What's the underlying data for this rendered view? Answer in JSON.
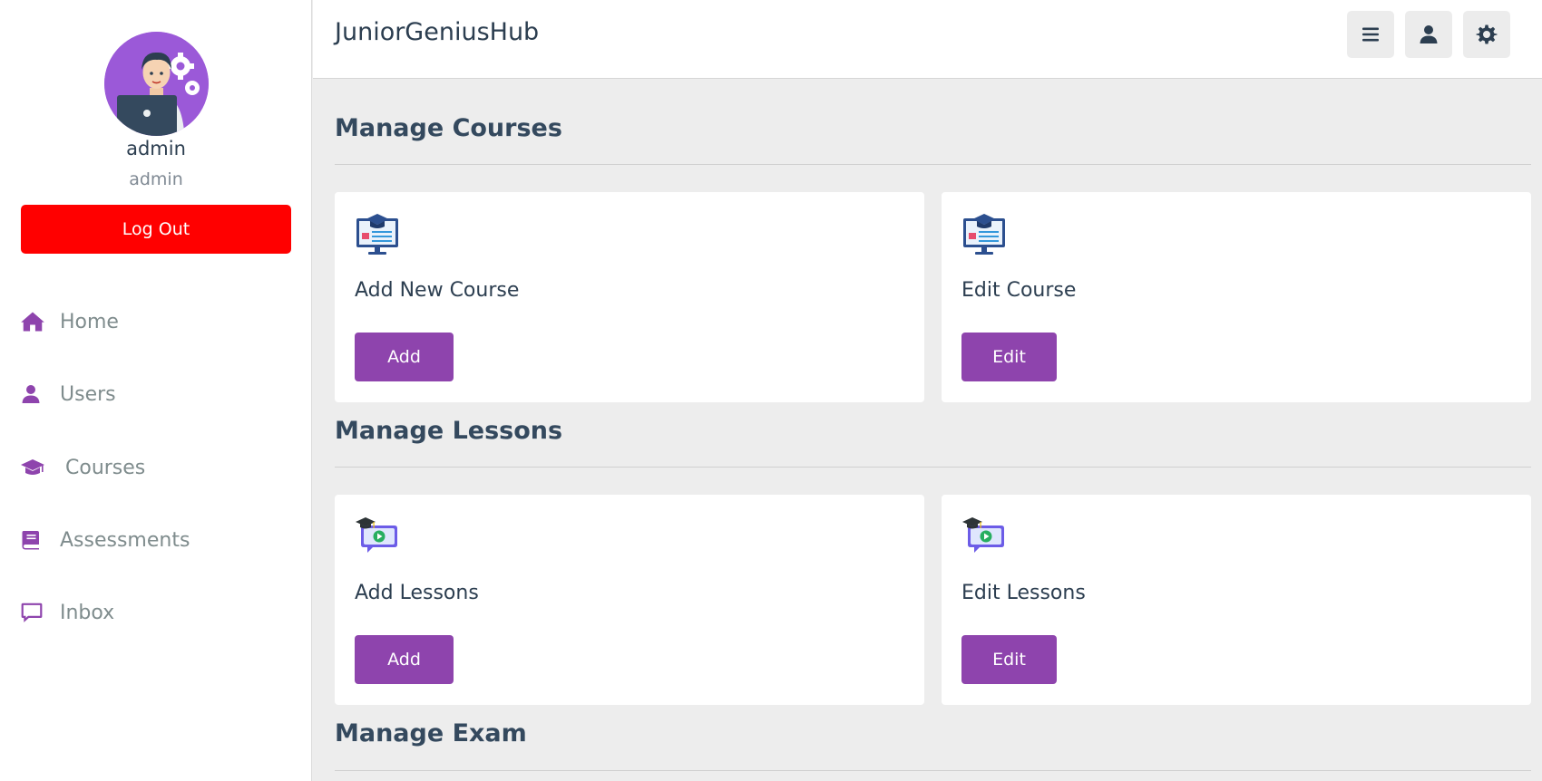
{
  "header": {
    "app_title": "JuniorGeniusHub"
  },
  "sidebar": {
    "user_name": "admin",
    "user_role": "admin",
    "logout_label": "Log Out",
    "nav": [
      {
        "label": "Home",
        "icon": "home-icon"
      },
      {
        "label": "Users",
        "icon": "user-icon"
      },
      {
        "label": "Courses",
        "icon": "graduation-cap-icon"
      },
      {
        "label": "Assessments",
        "icon": "book-icon"
      },
      {
        "label": "Inbox",
        "icon": "chat-icon"
      }
    ]
  },
  "sections": [
    {
      "title": "Manage Courses",
      "cards": [
        {
          "title": "Add New Course",
          "button": "Add",
          "icon": "course-monitor-icon"
        },
        {
          "title": "Edit Course",
          "button": "Edit",
          "icon": "course-monitor-icon"
        }
      ]
    },
    {
      "title": "Manage Lessons",
      "cards": [
        {
          "title": "Add Lessons",
          "button": "Add",
          "icon": "video-lesson-icon"
        },
        {
          "title": "Edit Lessons",
          "button": "Edit",
          "icon": "video-lesson-icon"
        }
      ]
    },
    {
      "title": "Manage Exam"
    }
  ],
  "colors": {
    "accent": "#8e44ad",
    "logout": "#ff0000",
    "background": "#ededed"
  }
}
